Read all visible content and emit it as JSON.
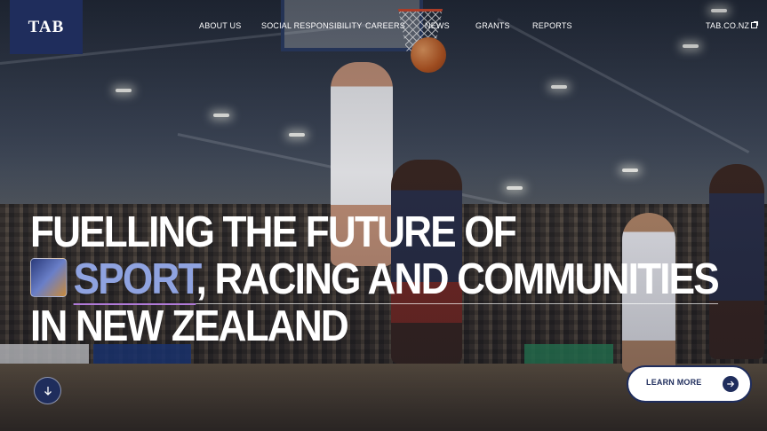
{
  "brand": {
    "logo_text": "TAB"
  },
  "nav": {
    "items": [
      {
        "label": "ABOUT US"
      },
      {
        "label": "SOCIAL RESPONSIBILITY"
      },
      {
        "label": "CAREERS"
      },
      {
        "label": "NEWS"
      },
      {
        "label": "GRANTS"
      },
      {
        "label": "REPORTS"
      }
    ],
    "external_link": {
      "label": "TAB.CO.NZ",
      "icon": "external-link-icon"
    }
  },
  "hero": {
    "headline_line1": "FUELLING THE FUTURE OF",
    "headline_highlight": "SPORT",
    "headline_line2_rest": ", RACING AND COMMUNITIES",
    "headline_line3": "IN NEW ZEALAND",
    "scroll_icon": "arrow-down-icon",
    "cta_label": "LEARN MORE",
    "cta_icon": "arrow-right-icon"
  },
  "colors": {
    "brand_navy": "#1f2d5c",
    "highlight": "#8fa3e0",
    "underline_accent": "#b07ad8"
  }
}
